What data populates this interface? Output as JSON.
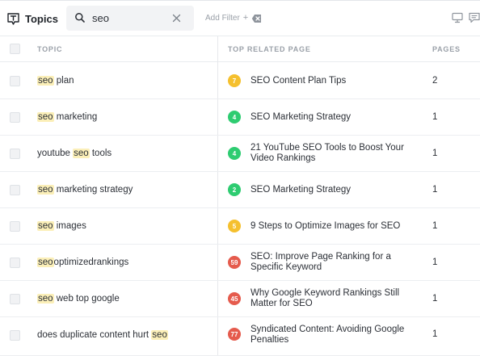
{
  "header": {
    "title": "Topics",
    "search_value": "seo",
    "add_filter_label": "Add Filter",
    "add_filter_plus": "+"
  },
  "columns": {
    "topic": "TOPIC",
    "top_related_page": "TOP RELATED PAGE",
    "pages": "PAGES"
  },
  "colors": {
    "badge_yellow": "#f5c02e",
    "badge_green": "#2ecc71",
    "badge_red": "#e55b4d",
    "highlight": "#fbefb8"
  },
  "rows": [
    {
      "topic_pre": "",
      "topic_hl": "seo",
      "topic_post": " plan",
      "score": "7",
      "score_color": "yellow",
      "page_title": "SEO Content Plan Tips",
      "pages": "2"
    },
    {
      "topic_pre": "",
      "topic_hl": "seo",
      "topic_post": " marketing",
      "score": "4",
      "score_color": "green",
      "page_title": "SEO Marketing Strategy",
      "pages": "1"
    },
    {
      "topic_pre": "youtube ",
      "topic_hl": "seo",
      "topic_post": " tools",
      "score": "4",
      "score_color": "green",
      "page_title": "21 YouTube SEO Tools to Boost Your Video Rankings",
      "pages": "1"
    },
    {
      "topic_pre": "",
      "topic_hl": "seo",
      "topic_post": " marketing strategy",
      "score": "2",
      "score_color": "green",
      "page_title": "SEO Marketing Strategy",
      "pages": "1"
    },
    {
      "topic_pre": "",
      "topic_hl": "seo",
      "topic_post": " images",
      "score": "5",
      "score_color": "yellow",
      "page_title": "9 Steps to Optimize Images for SEO",
      "pages": "1"
    },
    {
      "topic_pre": "",
      "topic_hl": "seo",
      "topic_post": "optimizedrankings",
      "score": "59",
      "score_color": "red",
      "page_title": "SEO: Improve Page Ranking for a Specific Keyword",
      "pages": "1"
    },
    {
      "topic_pre": "",
      "topic_hl": "seo",
      "topic_post": " web top google",
      "score": "45",
      "score_color": "red",
      "page_title": "Why Google Keyword Rankings Still Matter for SEO",
      "pages": "1"
    },
    {
      "topic_pre": "does duplicate content hurt ",
      "topic_hl": "seo",
      "topic_post": "",
      "score": "77",
      "score_color": "red",
      "page_title": "Syndicated Content: Avoiding Google Penalties",
      "pages": "1"
    }
  ]
}
